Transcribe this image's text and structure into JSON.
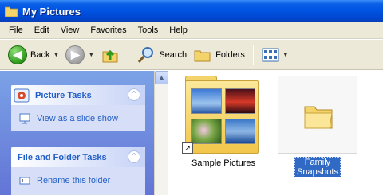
{
  "window": {
    "title": "My Pictures"
  },
  "menu": {
    "items": [
      "File",
      "Edit",
      "View",
      "Favorites",
      "Tools",
      "Help"
    ]
  },
  "toolbar": {
    "back_label": "Back",
    "search_label": "Search",
    "folders_label": "Folders"
  },
  "tasks": {
    "picture_tasks_title": "Picture Tasks",
    "view_slideshow_label": "View as a slide show",
    "file_folder_tasks_title": "File and Folder Tasks",
    "rename_folder_label": "Rename this folder"
  },
  "items": [
    {
      "label": "Sample Pictures"
    },
    {
      "label_line1": "Family",
      "label_line2": "Snapshots"
    }
  ],
  "colors": {
    "titlebar": "#0054e3",
    "task_pane": "#6375d6",
    "task_link": "#215dc6",
    "selection": "#316ac5"
  }
}
